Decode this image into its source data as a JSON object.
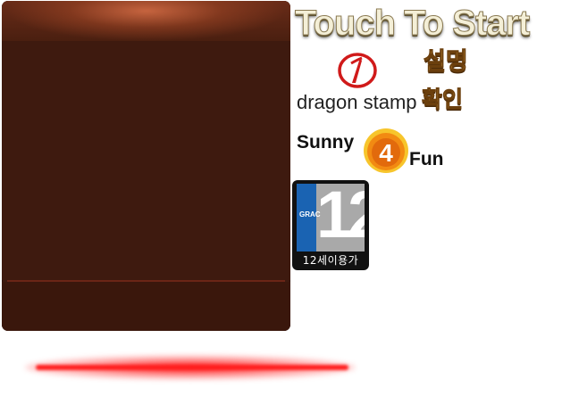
{
  "buttons": {
    "touch_to_start": "Touch To Start",
    "description": "설명",
    "confirm": "확인"
  },
  "logos": {
    "dragon_stamp": "dragon stamp",
    "sunny": "Sunny",
    "four": "4",
    "fun": "Fun"
  },
  "rating": {
    "org": "GRAC",
    "age": "12",
    "label": "12세이용가"
  },
  "colors": {
    "panel": "#3e1a0f",
    "panel_highlight": "#d46e46",
    "button_gold": "#f1b64b",
    "glow_red": "#ff1e1e",
    "logo_red": "#d01a1a",
    "badge_orange": "#f28a12"
  }
}
